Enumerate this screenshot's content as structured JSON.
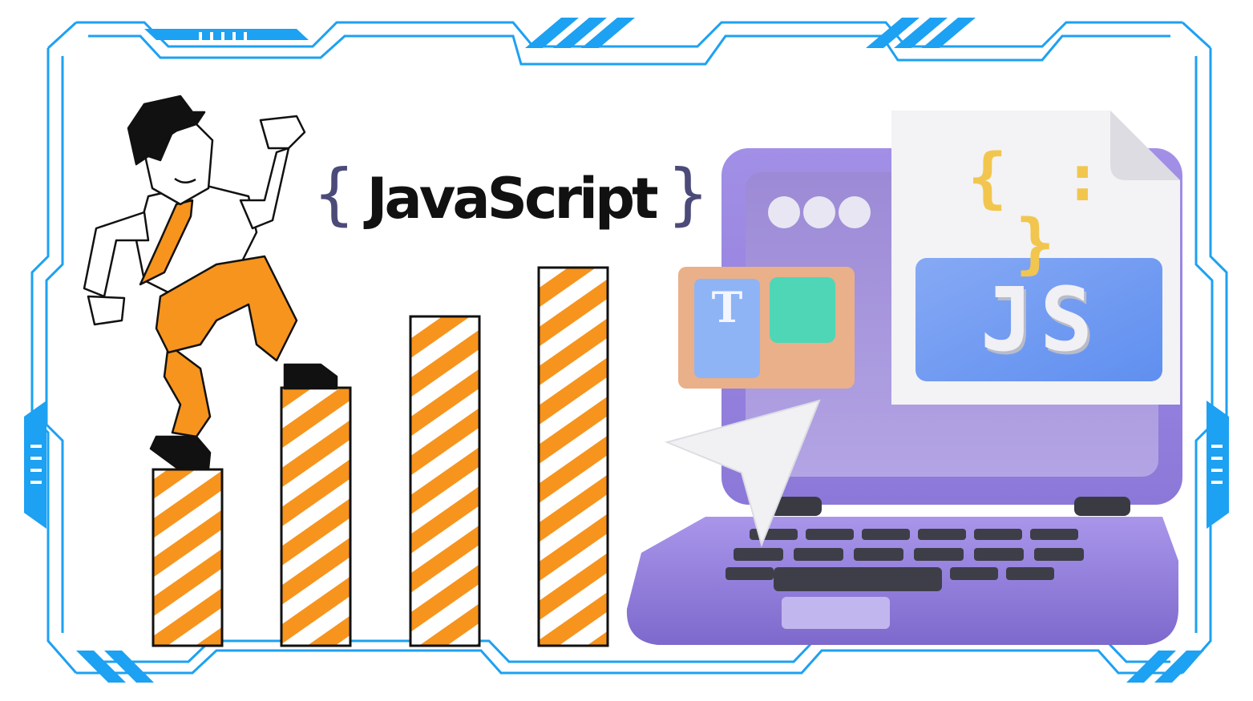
{
  "banner": {
    "title": "JavaScript",
    "brace_left": "{",
    "brace_right": "}"
  },
  "file_icon": {
    "code_symbol": "{ : }",
    "label": "JS"
  },
  "editor_panel": {
    "letter": "T"
  },
  "chart": {
    "bars": 4,
    "stripe_colors": [
      "#f7941d",
      "#ffffff"
    ]
  },
  "colors": {
    "frame_blue": "#1da1f2",
    "accent_orange": "#f7941d",
    "laptop_purple": "#9a86e0",
    "title_text": "#111111",
    "brace": "#4b4a78"
  }
}
